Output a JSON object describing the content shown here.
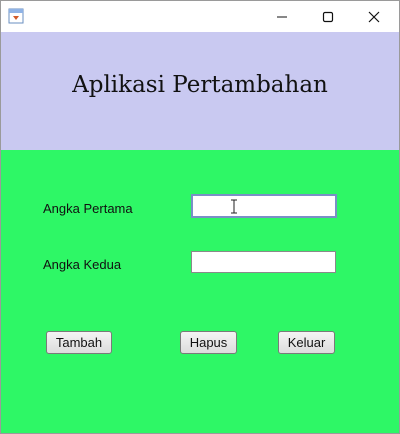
{
  "window": {
    "title": "",
    "icon": "java-app-icon",
    "controls": {
      "minimize_icon": "minimize-icon",
      "maximize_icon": "maximize-icon",
      "close_icon": "close-icon"
    }
  },
  "header": {
    "title": "Aplikasi Pertambahan",
    "background": "#c9c9f1"
  },
  "form": {
    "background": "#2ef766",
    "first_label": "Angka Pertama",
    "first_value": "",
    "second_label": "Angka Kedua",
    "second_value": ""
  },
  "actions": {
    "add_label": "Tambah",
    "clear_label": "Hapus",
    "exit_label": "Keluar"
  }
}
